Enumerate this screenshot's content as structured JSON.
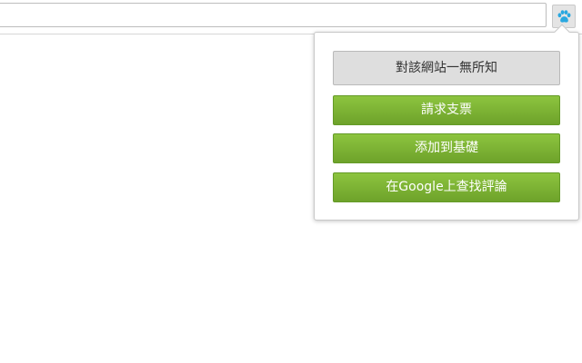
{
  "extension": {
    "icon": "paw-icon",
    "accent": "#29a8e0"
  },
  "popup": {
    "buttons": [
      {
        "label": "對該網站一無所知",
        "style": "gray",
        "color": "#dedede"
      },
      {
        "label": "請求支票",
        "style": "green",
        "color": "#7db435"
      },
      {
        "label": "添加到基礎",
        "style": "green",
        "color": "#7db435"
      },
      {
        "label": "在Google上查找評論",
        "style": "green",
        "color": "#7db435"
      }
    ]
  }
}
